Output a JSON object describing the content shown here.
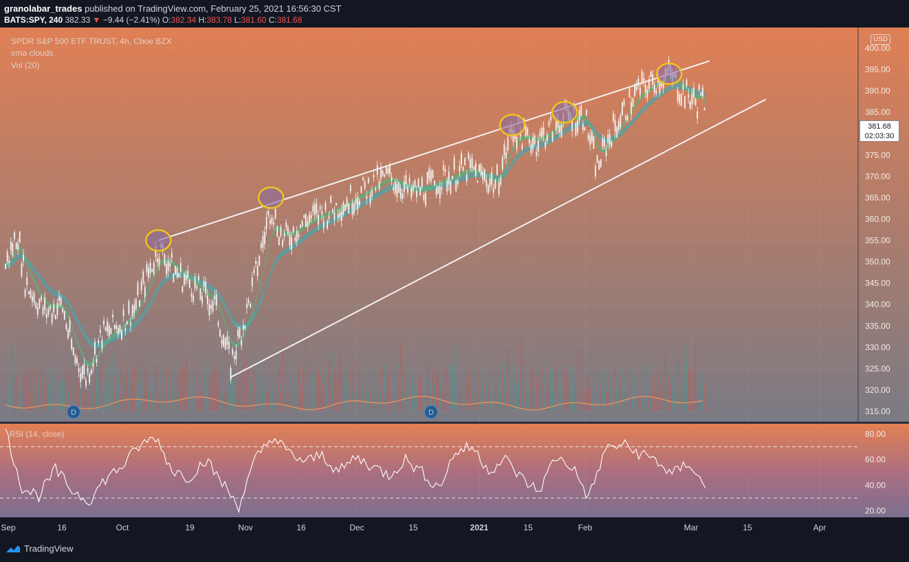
{
  "header": {
    "author": "granolabar_trades",
    "published_text": "published on TradingView.com, February 25, 2021 16:56:30 CST",
    "symbol": "BATS:SPY, 240",
    "last_price": "382.33",
    "change": "−9.44 (−2.41%)",
    "open_label": "O:",
    "open": "382.34",
    "high_label": "H:",
    "high": "383.78",
    "low_label": "L:",
    "low": "381.60",
    "close_label": "C:",
    "close": "381.68"
  },
  "legend": {
    "title": "SPDR S&P 500 ETF TRUST, 4h, Cboe BZX",
    "indicator1": "ema clouds",
    "indicator2": "Vol (20)",
    "rsi_label": "RSI (14, close)"
  },
  "price_tag": {
    "price": "381.68",
    "countdown": "02:03:30"
  },
  "currency": "USD",
  "dividend_badge": "D",
  "footer": {
    "brand": "TradingView"
  },
  "colors": {
    "background_top": "#e07f54",
    "background_bottom": "#7c7a82",
    "candle": "#f5f5f5",
    "ema_fast": "#5fae7a",
    "ema_slow": "#4fa3a8",
    "volume_line": "#e8955e",
    "rsi_line": "#ffffff",
    "trendline": "#f2f2f2",
    "highlight_circle": "#f2c31c",
    "highlight_fill": "#8a6b9e"
  },
  "chart_data": {
    "type": "line",
    "title": "SPDR S&P 500 ETF TRUST, 4h, Cboe BZX",
    "y_axis": {
      "ylim": [
        312,
        402
      ],
      "ticks": [
        "400.00",
        "395.00",
        "390.00",
        "385.00",
        "380.00",
        "375.00",
        "370.00",
        "365.00",
        "360.00",
        "355.00",
        "350.00",
        "345.00",
        "340.00",
        "335.00",
        "330.00",
        "325.00",
        "320.00",
        "315.00"
      ]
    },
    "x_axis": {
      "ticks": [
        "Sep",
        "16",
        "Oct",
        "19",
        "Nov",
        "16",
        "Dec",
        "15",
        "2021",
        "15",
        "Feb",
        "Mar",
        "15",
        "Apr"
      ]
    },
    "price_series_approx": [
      {
        "date": "Sep",
        "value": 349
      },
      {
        "date": "Sep 7",
        "value": 357
      },
      {
        "date": "Sep 9",
        "value": 345
      },
      {
        "date": "Sep 14",
        "value": 338
      },
      {
        "date": "Sep 18",
        "value": 340
      },
      {
        "date": "Sep 21",
        "value": 328
      },
      {
        "date": "Sep 24",
        "value": 323
      },
      {
        "date": "Sep 28",
        "value": 333
      },
      {
        "date": "Oct 2",
        "value": 335
      },
      {
        "date": "Oct 6",
        "value": 339
      },
      {
        "date": "Oct 12",
        "value": 353
      },
      {
        "date": "Oct 16",
        "value": 348
      },
      {
        "date": "Oct 21",
        "value": 344
      },
      {
        "date": "Oct 26",
        "value": 340
      },
      {
        "date": "Oct 30",
        "value": 326
      },
      {
        "date": "Nov 3",
        "value": 338
      },
      {
        "date": "Nov 9",
        "value": 363
      },
      {
        "date": "Nov 12",
        "value": 355
      },
      {
        "date": "Nov 18",
        "value": 360
      },
      {
        "date": "Nov 24",
        "value": 362
      },
      {
        "date": "Dec 1",
        "value": 366
      },
      {
        "date": "Dec 8",
        "value": 370
      },
      {
        "date": "Dec 14",
        "value": 366
      },
      {
        "date": "Dec 21",
        "value": 369
      },
      {
        "date": "Dec 28",
        "value": 372
      },
      {
        "date": "Jan 4",
        "value": 368
      },
      {
        "date": "Jan 8",
        "value": 381
      },
      {
        "date": "Jan 14",
        "value": 378
      },
      {
        "date": "Jan 21",
        "value": 384
      },
      {
        "date": "Jan 26",
        "value": 384
      },
      {
        "date": "Jan 29",
        "value": 372
      },
      {
        "date": "Feb 2",
        "value": 381
      },
      {
        "date": "Feb 8",
        "value": 390
      },
      {
        "date": "Feb 12",
        "value": 392
      },
      {
        "date": "Feb 16",
        "value": 394
      },
      {
        "date": "Feb 19",
        "value": 390
      },
      {
        "date": "Feb 23",
        "value": 387
      },
      {
        "date": "Feb 24",
        "value": 391
      },
      {
        "date": "Feb 25",
        "value": 381.68
      }
    ],
    "trendlines": [
      {
        "name": "upper",
        "from": {
          "date": "Oct 12",
          "value": 355
        },
        "to": {
          "date": "Feb 26",
          "value": 397
        }
      },
      {
        "name": "lower",
        "from": {
          "date": "Oct 30",
          "value": 323
        },
        "to": {
          "date": "Mar 12",
          "value": 388
        }
      }
    ],
    "highlighted_tops": [
      {
        "date": "Oct 12",
        "value": 355
      },
      {
        "date": "Nov 9",
        "value": 365
      },
      {
        "date": "Jan 8",
        "value": 382
      },
      {
        "date": "Jan 21",
        "value": 385
      },
      {
        "date": "Feb 16",
        "value": 394
      }
    ],
    "rsi": {
      "label": "RSI (14, close)",
      "ylim": [
        15,
        88
      ],
      "ticks": [
        "80.00",
        "60.00",
        "40.00",
        "20.00"
      ],
      "bands": [
        70,
        30
      ],
      "values": [
        83,
        38,
        32,
        52,
        36,
        28,
        45,
        55,
        70,
        78,
        52,
        46,
        60,
        42,
        24,
        60,
        78,
        65,
        58,
        64,
        50,
        62,
        55,
        48,
        60,
        50,
        38,
        66,
        70,
        52,
        60,
        45,
        35,
        62,
        55,
        30,
        68,
        72,
        65,
        60,
        48,
        58,
        38
      ]
    }
  }
}
